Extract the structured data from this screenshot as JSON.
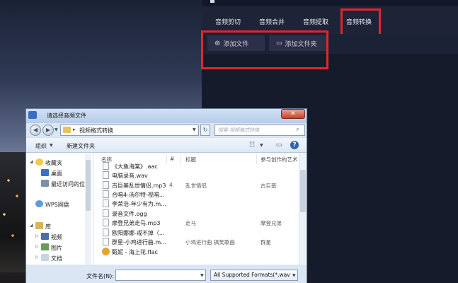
{
  "app": {
    "tabs": [
      "音频剪切",
      "音频合并",
      "音频提取",
      "音频转换"
    ],
    "add_file": "添加文件",
    "add_folder": "添加文件夹"
  },
  "dialog": {
    "title": "请选择音频文件",
    "breadcrumb": "视频格式转换",
    "search_placeholder": "搜索 视频格式转换",
    "toolbar": {
      "organize": "组织",
      "new_folder": "新建文件夹"
    },
    "nav": {
      "favorites": "收藏夹",
      "desktop": "桌面",
      "recent": "最近访问的位",
      "wps": "WPS网盘",
      "library": "库",
      "videos": "视频",
      "pictures": "图片",
      "documents": "文档"
    },
    "columns": [
      "名称",
      "#",
      "标题",
      "参与创作的艺术"
    ],
    "files": [
      {
        "name": "《大鱼海棠》.aac",
        "num": "",
        "title": "",
        "artist": ""
      },
      {
        "name": "电脑录音.wav",
        "num": "",
        "title": "",
        "artist": ""
      },
      {
        "name": "古巨基乱世情侣.mp3",
        "num": "4",
        "title": "乱世情侣",
        "artist": "古巨基"
      },
      {
        "name": "合唱4-汤尔特-视唱...",
        "num": "",
        "title": "",
        "artist": ""
      },
      {
        "name": "李荣浩-年少有为.m...",
        "num": "",
        "title": "",
        "artist": ""
      },
      {
        "name": "录音文件.ogg",
        "num": "",
        "title": "",
        "artist": ""
      },
      {
        "name": "摩登兄弟走马.mp3",
        "num": "",
        "title": "走马",
        "artist": "摩登兄弟"
      },
      {
        "name": "欧阳娜娜-戒不掉（...",
        "num": "",
        "title": "",
        "artist": ""
      },
      {
        "name": "群星-小鸡进行曲.m...",
        "num": "",
        "title": "小鸡进行曲 搞笑歌曲",
        "artist": "群星"
      },
      {
        "name": "甄妮 - 海上花.flac",
        "num": "",
        "title": "",
        "artist": ""
      }
    ],
    "filename_label": "文件名(N):",
    "filename_value": "",
    "filter": "All Supported Formats(*.wav"
  },
  "colors": {
    "highlight": "#e1262b",
    "app_bg": "#1b2033"
  }
}
